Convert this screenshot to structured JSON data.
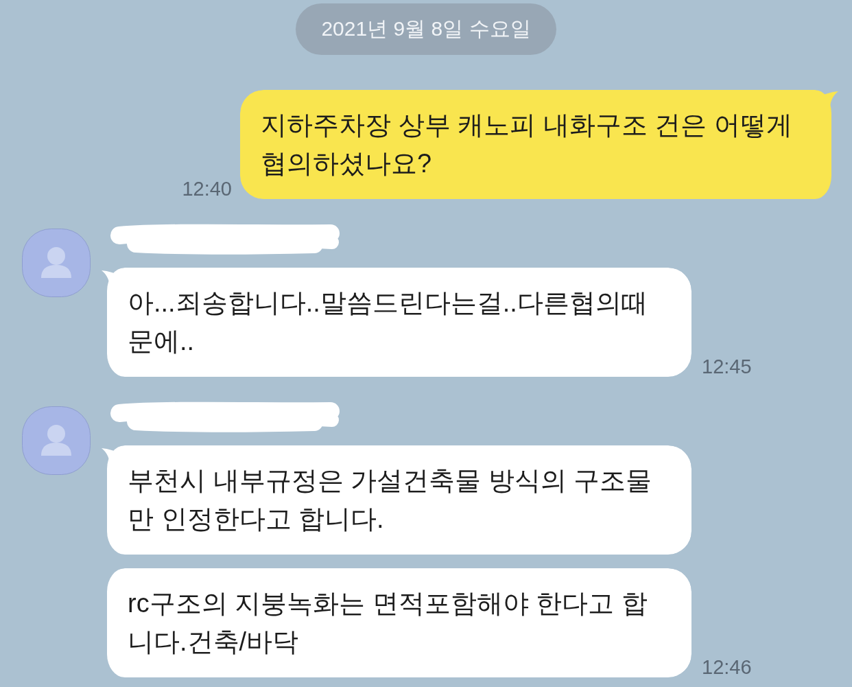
{
  "date_divider": {
    "text": "2021년 9월 8일 수요일"
  },
  "messages": [
    {
      "kind": "outgoing",
      "time": "12:40",
      "bubbles": [
        "지하주차장 상부 캐노피 내화구조 건은 어떻게 협의하셨나요?"
      ]
    },
    {
      "kind": "incoming",
      "name_hidden": true,
      "time": "12:45",
      "bubbles": [
        "아...죄송합니다..말씀드린다는걸..다른협의때문에.."
      ]
    },
    {
      "kind": "incoming",
      "name_hidden": true,
      "time": "12:46",
      "bubbles": [
        "부천시 내부규정은 가설건축물 방식의 구조물만 인정한다고 합니다.",
        "rc구조의 지붕녹화는 면적포함해야 한다고 합니다.건축/바닥"
      ]
    }
  ]
}
